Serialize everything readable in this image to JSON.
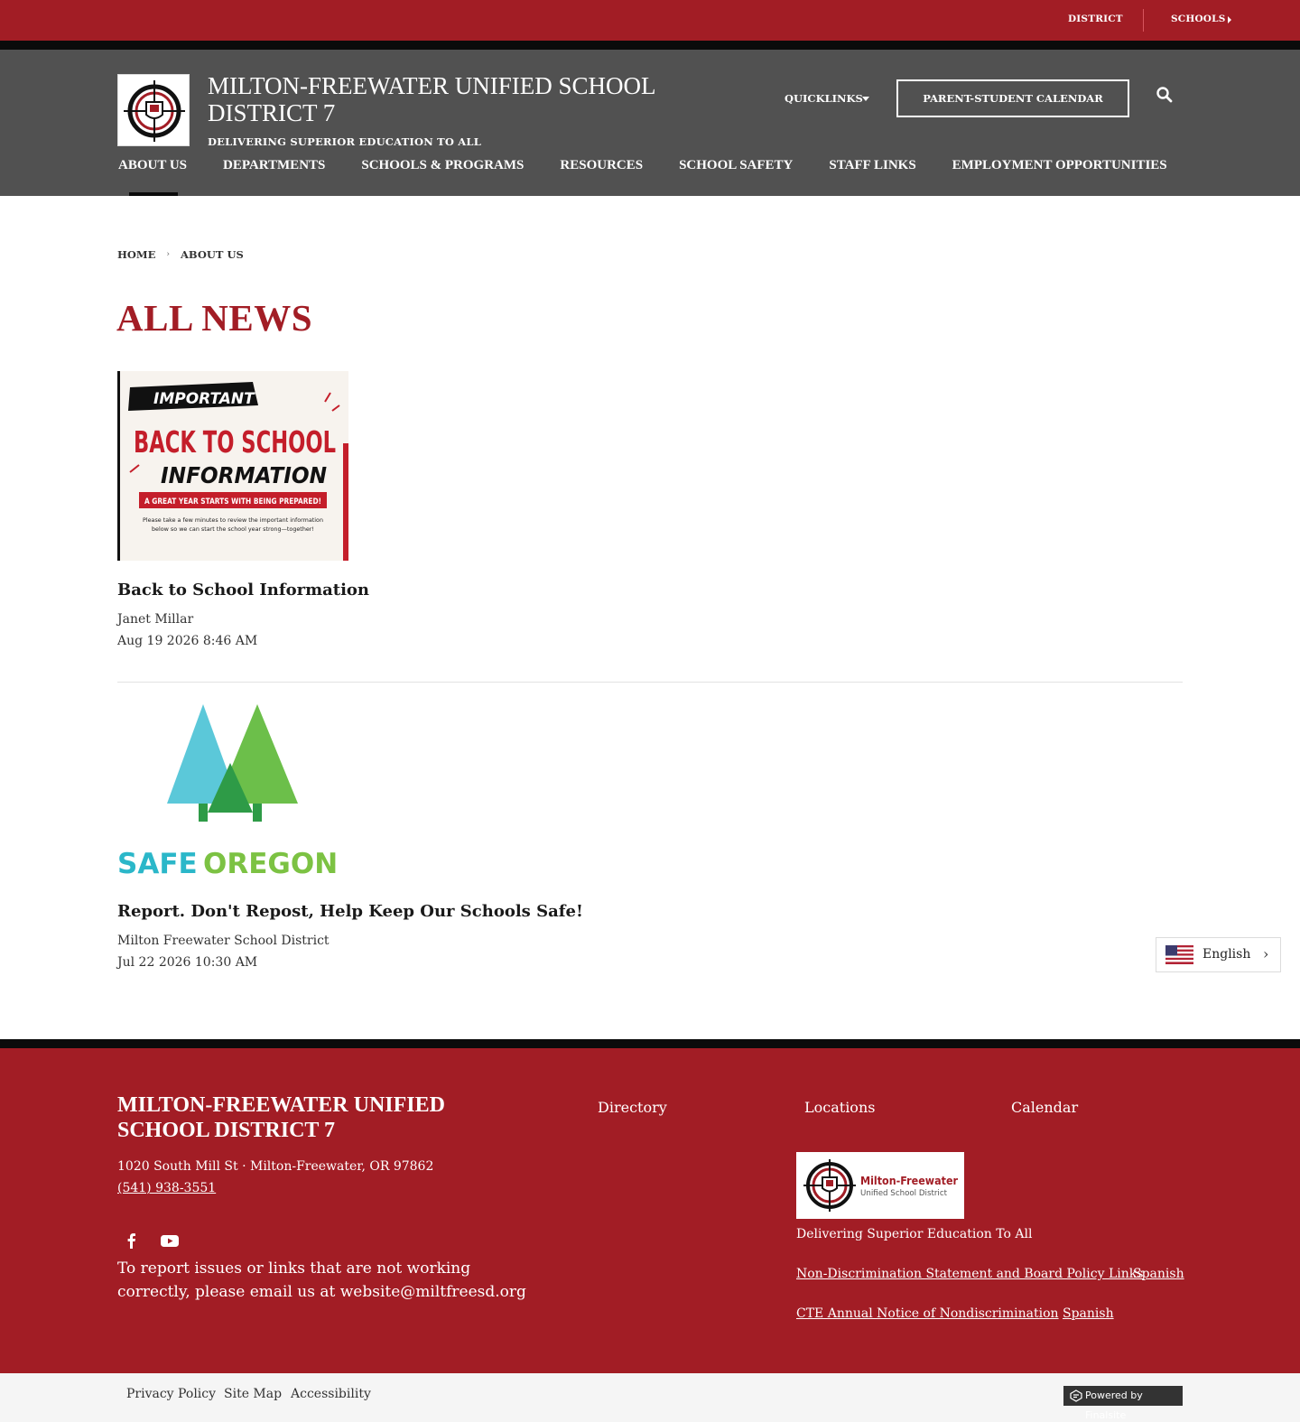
{
  "topbar": {
    "district": "DISTRICT",
    "schools": "SCHOOLS"
  },
  "header": {
    "site_title": "MILTON-FREEWATER UNIFIED SCHOOL DISTRICT 7",
    "tagline": "DELIVERING SUPERIOR EDUCATION TO ALL",
    "quicklinks": "QUICKLINKS",
    "calendar_button": "PARENT-STUDENT CALENDAR"
  },
  "nav": {
    "items": [
      {
        "label": "ABOUT US"
      },
      {
        "label": "DEPARTMENTS"
      },
      {
        "label": "SCHOOLS & PROGRAMS"
      },
      {
        "label": "RESOURCES"
      },
      {
        "label": "SCHOOL SAFETY"
      },
      {
        "label": "STAFF LINKS"
      },
      {
        "label": "EMPLOYMENT OPPORTUNITIES"
      }
    ]
  },
  "breadcrumb": {
    "home": "HOME",
    "current": "ABOUT US"
  },
  "page_title": "ALL NEWS",
  "news": [
    {
      "image": {
        "tag": "IMPORTANT",
        "headline1": "BACK TO SCHOOL",
        "headline2": "INFORMATION",
        "banner": "A GREAT YEAR STARTS WITH BEING PREPARED!",
        "note1": "Please take a few minutes to review the important information",
        "note2": "below so we can start the school year strong—together!"
      },
      "title": "Back to School Information",
      "author": "Janet Millar",
      "date": "Aug 19 2026 8:46 AM"
    },
    {
      "image": {
        "brand_a": "SAFE",
        "brand_b": "OREGON"
      },
      "title": "Report. Don't Repost, Help Keep Our Schools Safe!",
      "author": "Milton Freewater School District",
      "date": "Jul 22 2026 10:30 AM"
    }
  ],
  "translate": {
    "language": "English"
  },
  "footer": {
    "title": "MILTON-FREEWATER UNIFIED SCHOOL DISTRICT 7",
    "address": "1020 South Mill St · Milton-Freewater, OR  97862",
    "phone": "(541) 938-3551",
    "report_text": "To report issues or links that are not working correctly, please email us at website@miltfreesd.org",
    "links": {
      "directory": "Directory",
      "locations": "Locations",
      "calendar": "Calendar"
    },
    "logo": {
      "name": "Milton-Freewater",
      "sub": "Unified School District"
    },
    "tagline": "Delivering Superior Education To All",
    "nondiscrimination": "Non-Discrimination Statement and Board Policy Links",
    "spanish_1": "Spanish",
    "cte_notice": "CTE Annual Notice of Nondiscrimination",
    "spanish_2": "Spanish"
  },
  "bottom": {
    "privacy": "Privacy Policy",
    "sitemap": "Site Map",
    "accessibility": "Accessibility",
    "powered": "Powered by Finalsite"
  },
  "colors": {
    "brand_red": "#a21d25",
    "header_gray": "#515151",
    "black": "#0b0b0b"
  },
  "icons": [
    "search-icon",
    "facebook-icon",
    "youtube-icon",
    "chevron-right-icon",
    "us-flag-icon"
  ]
}
